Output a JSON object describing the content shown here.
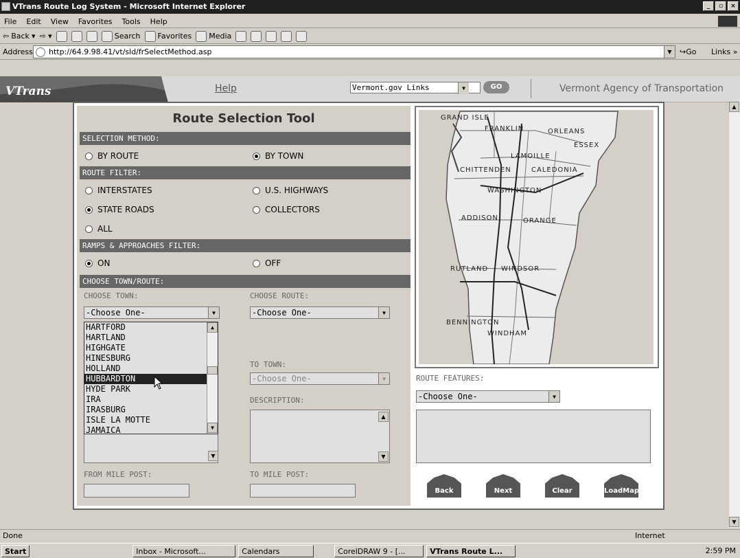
{
  "window": {
    "title": "VTrans Route Log System - Microsoft Internet Explorer",
    "min": "_",
    "max": "▫",
    "close": "×"
  },
  "menu": [
    "File",
    "Edit",
    "View",
    "Favorites",
    "Tools",
    "Help"
  ],
  "toolbar": {
    "back": "Back",
    "search": "Search",
    "favorites": "Favorites",
    "media": "Media"
  },
  "address": {
    "label": "Address",
    "url": "http://64.9.98.41/vt/sld/frSelectMethod.asp",
    "go": "Go",
    "links": "Links »"
  },
  "banner": {
    "logo": "VTrans",
    "help": "Help",
    "links_select": "Vermont.gov Links",
    "go": "GO",
    "agency": "Vermont Agency of Transportation"
  },
  "form": {
    "title": "Route Selection Tool",
    "selection_method": "SELECTION METHOD:",
    "by_route": "BY ROUTE",
    "by_town": "BY TOWN",
    "route_filter": "ROUTE FILTER:",
    "interstates": "INTERSTATES",
    "us_highways": "U.S. HIGHWAYS",
    "state_roads": "STATE ROADS",
    "collectors": "COLLECTORS",
    "all": "ALL",
    "ramps_filter": "RAMPS & APPROACHES FILTER:",
    "on": "ON",
    "off": "OFF",
    "choose_town_route": "CHOOSE TOWN/ROUTE:",
    "choose_town": "CHOOSE TOWN:",
    "choose_route": "CHOOSE ROUTE:",
    "choose_one": "-Choose One-",
    "to_town": "TO TOWN:",
    "description": "DESCRIPTION:",
    "from_mile_post": "FROM MILE POST:",
    "to_mile_post": "TO MILE POST:",
    "route_features": "ROUTE FEATURES:"
  },
  "town_list": [
    "HARTFORD",
    "HARTLAND",
    "HIGHGATE",
    "HINESBURG",
    "HOLLAND",
    "HUBBARDTON",
    "HYDE PARK",
    "IRA",
    "IRASBURG",
    "ISLE LA MOTTE",
    "JAMAICA"
  ],
  "selected_town_index": 5,
  "map_labels": {
    "grand_isle": "GRAND ISLE",
    "franklin": "FRANKLIN",
    "orleans": "ORLEANS",
    "essex": "ESSEX",
    "lamoille": "LAMOILLE",
    "chittenden": "CHITTENDEN",
    "caledonia": "CALEDONIA",
    "washington": "WASHINGTON",
    "addison": "ADDISON",
    "orange": "ORANGE",
    "rutland": "RUTLAND",
    "windsor": "WINDSOR",
    "bennington": "BENNINGTON",
    "windham": "WINDHAM"
  },
  "buttons": {
    "back": "Back",
    "next": "Next",
    "clear": "Clear",
    "loadmap": "LoadMap"
  },
  "status": {
    "text": "Done",
    "zone": "Internet"
  },
  "taskbar": {
    "start": "Start",
    "items": [
      "Inbox - Microsoft...",
      "Calendars",
      "CorelDRAW 9 - [...",
      "VTrans Route L..."
    ],
    "time": "2:59 PM"
  }
}
